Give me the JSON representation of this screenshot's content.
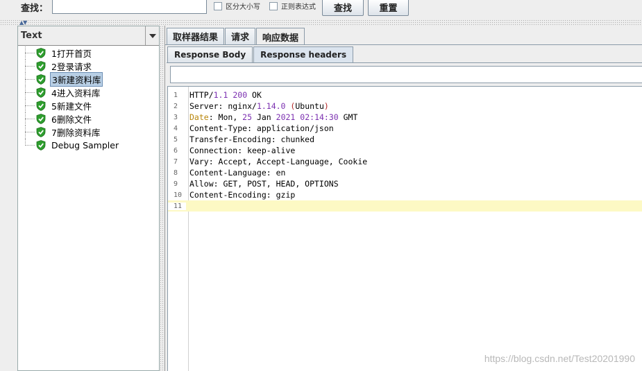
{
  "search_bar": {
    "label": "查找：",
    "input_value": "",
    "case_sensitive_label": "区分大小写",
    "regex_label": "正则表达式",
    "find_button": "查找",
    "reset_button": "重置"
  },
  "left_panel": {
    "renderer": "Text",
    "tree_items": [
      {
        "label": "1打开首页",
        "status": "success"
      },
      {
        "label": "2登录请求",
        "status": "success"
      },
      {
        "label": "3新建资料库",
        "status": "success",
        "selected": true
      },
      {
        "label": "4进入资料库",
        "status": "success"
      },
      {
        "label": "5新建文件",
        "status": "success"
      },
      {
        "label": "6删除文件",
        "status": "success"
      },
      {
        "label": "7删除资料库",
        "status": "success"
      },
      {
        "label": "Debug Sampler",
        "status": "success"
      }
    ]
  },
  "tabs": [
    {
      "label": "取样器结果",
      "active": false
    },
    {
      "label": "请求",
      "active": false
    },
    {
      "label": "响应数据",
      "active": true
    }
  ],
  "subtabs": [
    {
      "label": "Response Body",
      "active": false
    },
    {
      "label": "Response headers",
      "active": true
    }
  ],
  "response_search_value": "",
  "editor": {
    "current_line": 11,
    "lines": [
      "HTTP/1.1 200 OK",
      "Server: nginx/1.14.0 (Ubuntu)",
      "Date: Mon, 25 Jan 2021 02:14:30 GMT",
      "Content-Type: application/json",
      "Transfer-Encoding: chunked",
      "Connection: keep-alive",
      "Vary: Accept, Accept-Language, Cookie",
      "Content-Language: en",
      "Allow: GET, POST, HEAD, OPTIONS",
      "Content-Encoding: gzip",
      ""
    ]
  },
  "watermark": "https://blog.csdn.net/Test20201990",
  "colors": {
    "success_icon": "#2e9e2e",
    "selection": "#b8cfe5",
    "current_line": "#fdf9c4",
    "number_token": "#7b2fb0"
  }
}
